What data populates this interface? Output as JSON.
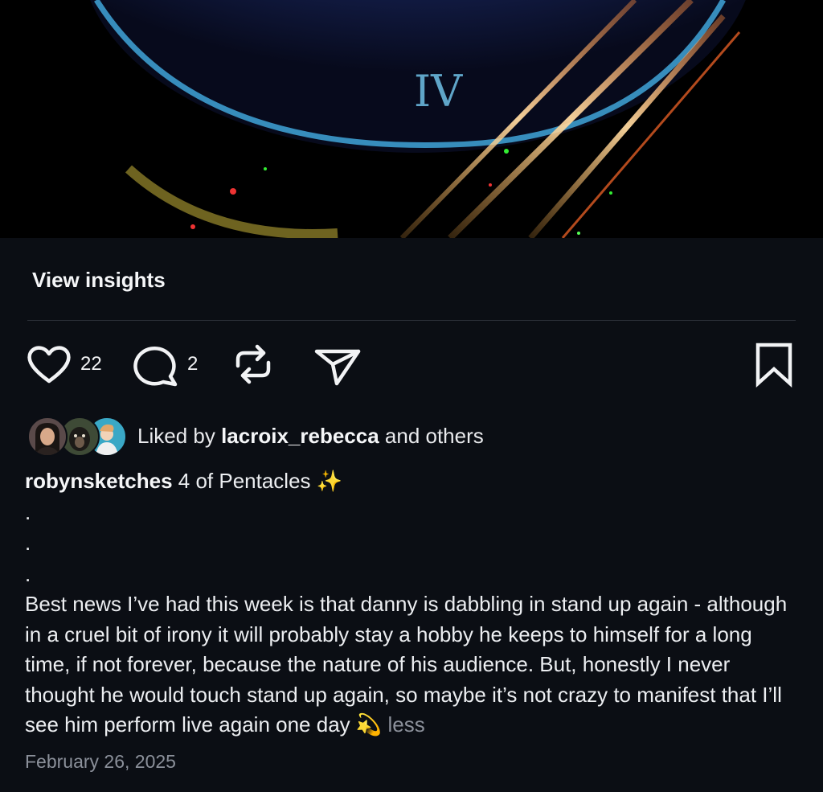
{
  "hero": {
    "numeral": "IV"
  },
  "insights": {
    "label": "View insights"
  },
  "actions": {
    "likes": "22",
    "comments": "2"
  },
  "liked_by": {
    "prefix": "Liked by ",
    "user": "lacroix_rebecca",
    "suffix": " and others"
  },
  "caption": {
    "username": "robynsketches",
    "title": " 4 of Pentacles ✨",
    "dot1": ".",
    "dot2": ".",
    "dot3": ".",
    "body": "Best news I’ve had this week is that danny is dabbling in stand up again - although in a cruel bit of irony it will probably stay a hobby he keeps to himself for a long time, if not forever, because the nature of his audience. But, honestly I never thought he would touch stand up again, so maybe it’s not crazy to manifest that I’ll see him perform live again one day 💫 ",
    "less_label": "less"
  },
  "date": "February 26, 2025"
}
